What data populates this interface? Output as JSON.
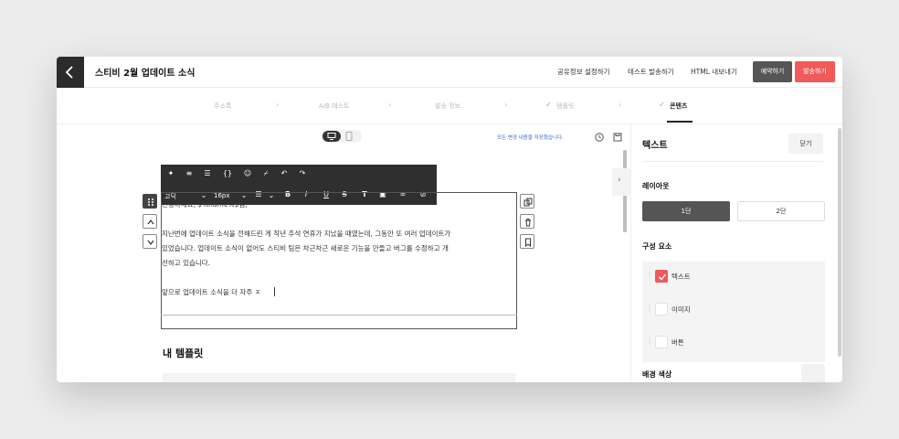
{
  "header": {
    "title": "스티비 2월 업데이트 소식",
    "links": [
      "공유정보 설정하기",
      "테스트 발송하기",
      "HTML 내보내기"
    ],
    "reserve_label": "예약하기",
    "send_label": "발송하기",
    "send_color": "#f05a5a"
  },
  "steps": {
    "items": [
      "주소록",
      "A/B 테스트",
      "발송 정보",
      "템플릿",
      "콘텐츠"
    ]
  },
  "editor": {
    "auto_save": "모든 변경 내용을 저장했습니다.",
    "toolbar": {
      "font": "고딕",
      "size": "16px"
    },
    "lines": [
      "안녕하세요, $%name%$님,",
      "지난번에 업데이트 소식을 전해드린 게 작년 추석 연휴가 지났을 때였는데, 그동안 또 여러 업데이트가",
      "있었습니다. 업데이트 소식이 없어도 스티비 팀은 차근차근 새로운 기능을 만들고 버그를 수정하고 개",
      "선하고 있습니다.",
      "앞으로 업데이트 소식을 더 자주 ㅈ"
    ],
    "templates_title": "내 템플릿"
  },
  "panel": {
    "title": "텍스트",
    "close_label": "닫기",
    "layout_label": "레이아웃",
    "layout_options": [
      "1단",
      "2단"
    ],
    "components_label": "구성 요소",
    "components": [
      {
        "label": "텍스트",
        "checked": true
      },
      {
        "label": "이미지",
        "checked": false
      },
      {
        "label": "버튼",
        "checked": false
      }
    ],
    "bg_color_label": "배경 색상"
  }
}
